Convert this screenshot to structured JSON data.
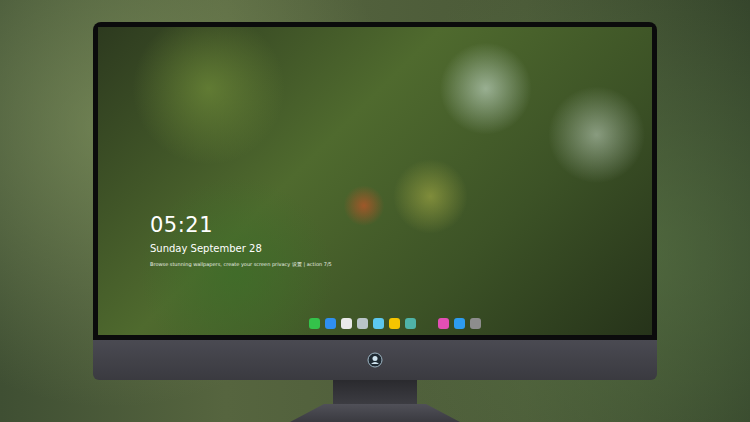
{
  "lock_screen": {
    "time": "05:21",
    "date": "Sunday September 28",
    "notice": "Browse stunning wallpapers, create your screen privacy 设置 | action 7/5"
  },
  "dock": {
    "items": [
      {
        "kind": "app",
        "color": "#34c24a"
      },
      {
        "kind": "app",
        "color": "#2f8ff0"
      },
      {
        "kind": "app",
        "color": "#e9e9e9"
      },
      {
        "kind": "app",
        "color": "#b9c4c9"
      },
      {
        "kind": "app",
        "color": "#5cc8f0"
      },
      {
        "kind": "app",
        "color": "#f5c400"
      },
      {
        "kind": "app",
        "color": "#4fb3a8"
      },
      {
        "kind": "separator",
        "color": "#000000"
      },
      {
        "kind": "app",
        "color": "#e24fb4"
      },
      {
        "kind": "app",
        "color": "#2d9cf0"
      },
      {
        "kind": "app",
        "color": "#8d8d8d"
      }
    ]
  }
}
